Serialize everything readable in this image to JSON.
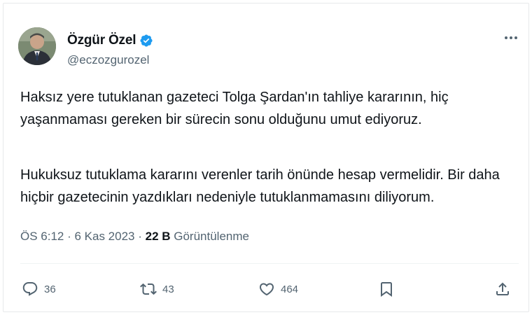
{
  "author": {
    "name": "Özgür Özel",
    "handle": "@eczozgurozel",
    "verified_color": "#1d9bf0"
  },
  "tweet": {
    "paragraphs": [
      "Haksız yere tutuklanan gazeteci Tolga Şardan'ın tahliye kararının, hiç yaşanmaması gereken bir sürecin sonu olduğunu umut ediyoruz.",
      "Hukuksuz tutuklama kararını verenler tarih önünde hesap vermelidir. Bir daha hiçbir gazetecinin yazdıkları nedeniyle tutuklanmamasını diliyorum."
    ]
  },
  "meta": {
    "time": "ÖS 6:12",
    "separator": " · ",
    "date": "6 Kas 2023",
    "separator2": " · ",
    "views_count": "22 B",
    "views_label": " Görüntülenme"
  },
  "actions": {
    "reply": {
      "icon": "reply-icon",
      "count": "36"
    },
    "retweet": {
      "icon": "retweet-icon",
      "count": "43"
    },
    "like": {
      "icon": "heart-icon",
      "count": "464"
    },
    "bookmark": {
      "icon": "bookmark-icon"
    },
    "share": {
      "icon": "share-icon"
    }
  }
}
